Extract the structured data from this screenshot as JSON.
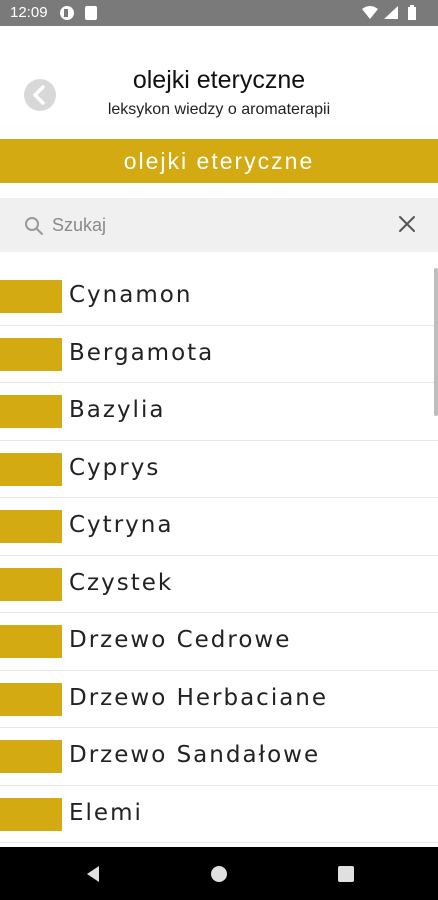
{
  "status_bar": {
    "time": "12:09"
  },
  "header": {
    "title": "olejki eteryczne",
    "subtitle": "leksykon wiedzy o aromaterapii"
  },
  "banner": {
    "title": "olejki eteryczne"
  },
  "search": {
    "placeholder": "Szukaj",
    "value": ""
  },
  "list": {
    "items": [
      {
        "label": "Cynamon"
      },
      {
        "label": "Bergamota"
      },
      {
        "label": "Bazylia"
      },
      {
        "label": "Cyprys"
      },
      {
        "label": "Cytryna"
      },
      {
        "label": "Czystek"
      },
      {
        "label": "Drzewo Cedrowe"
      },
      {
        "label": "Drzewo Herbaciane"
      },
      {
        "label": "Drzewo Sandałowe"
      },
      {
        "label": "Elemi"
      }
    ]
  },
  "colors": {
    "accent": "#d4aa12",
    "status_bar": "#7a7a7a",
    "search_bg": "#f0f0f0"
  },
  "icons": {
    "back": "chevron-left-icon",
    "search": "search-icon",
    "clear": "close-icon",
    "nav_back": "triangle-back-icon",
    "nav_home": "circle-home-icon",
    "nav_recents": "square-recents-icon"
  }
}
